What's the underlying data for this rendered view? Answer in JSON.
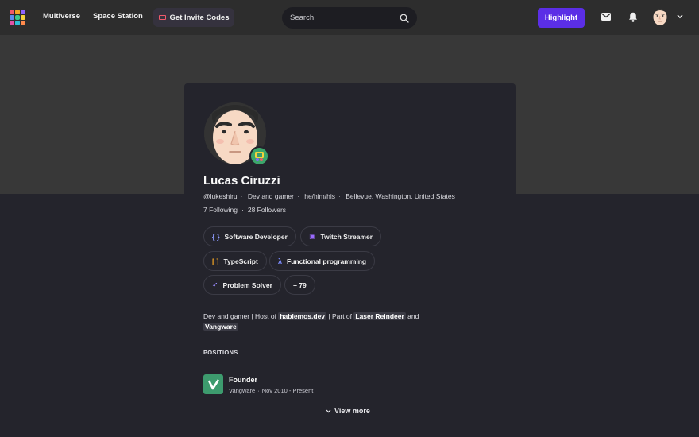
{
  "nav": {
    "links": [
      "Multiverse",
      "Space Station"
    ],
    "invite_label": "Get Invite Codes",
    "search_placeholder": "Search",
    "highlight_label": "Highlight",
    "logo_colors": [
      "#f0596b",
      "#f5a623",
      "#8e63ff",
      "#5b8df0",
      "#3cc98b",
      "#f5d33c",
      "#e052a6",
      "#2fbfd6",
      "#ff8a4c"
    ]
  },
  "profile": {
    "name": "Lucas Ciruzzi",
    "meta": [
      "@lukeshiru",
      "Dev and gamer",
      "he/him/his",
      "Bellevue, Washington, United States"
    ],
    "following": "7 Following",
    "followers": "28 Followers",
    "chips": [
      {
        "label": "Software Developer",
        "icon": "braces-icon",
        "icon_char": "{ }",
        "color": "#8e9cff"
      },
      {
        "label": "Twitch Streamer",
        "icon": "twitch-icon",
        "icon_char": "▣",
        "color": "#9b6bff"
      },
      {
        "label": "TypeScript",
        "icon": "brackets-icon",
        "icon_char": "[ ]",
        "color": "#f5a623"
      },
      {
        "label": "Functional programming",
        "icon": "lambda-icon",
        "icon_char": "λ",
        "color": "#7d8cff"
      },
      {
        "label": "Problem Solver",
        "icon": "rocket-icon",
        "icon_char": "➶",
        "color": "#9b8bff"
      },
      {
        "label": "+ 79",
        "icon": "",
        "icon_char": "",
        "color": "#ffffff"
      }
    ],
    "bio": {
      "part1": "Dev and gamer | Host of ",
      "hl1": "hablemos.dev",
      "part2": " | Part of ",
      "hl2": "Laser Reindeer",
      "part3": " and ",
      "hl3": "Vangware"
    },
    "positions_heading": "POSITIONS",
    "position": {
      "title": "Founder",
      "company": "Vangware",
      "dates": "Nov 2010 - Present"
    },
    "view_more": "View more"
  }
}
